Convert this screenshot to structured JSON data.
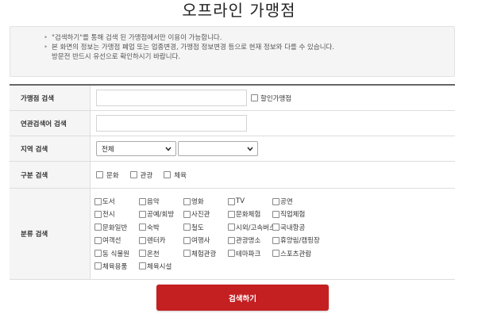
{
  "page": {
    "title": "오프라인 가맹점"
  },
  "notice": {
    "lines": [
      "\"검색하기\"를 통해 검색 된 가맹점에서만 이용이 가능합니다.",
      "본 화면의 정보는 가맹점 폐업 또는 업종변경, 가맹점 정보변경 등으로 현재 정보와 다를 수 있습니다.",
      "방문전 반드시 유선으로 확인하시기 바랍니다."
    ]
  },
  "form": {
    "store_search": {
      "label": "가맹점 검색",
      "value": "",
      "discount_label": "할인가맹점"
    },
    "keyword_search": {
      "label": "연관검색어 검색",
      "value": ""
    },
    "region_search": {
      "label": "지역 검색",
      "region1_selected": "전체",
      "region2_selected": ""
    },
    "type_search": {
      "label": "구분 검색",
      "options": [
        "문화",
        "관광",
        "체육"
      ]
    },
    "category_search": {
      "label": "분류 검색",
      "items": [
        "도서",
        "음악",
        "영화",
        "TV",
        "공연",
        "전시",
        "공예/회방",
        "사진관",
        "문화체험",
        "직업체험",
        "문화일반",
        "숙박",
        "철도",
        "시외/고속버스",
        "국내항공",
        "여객선",
        "렌터카",
        "여행사",
        "관광명소",
        "휴양림/캠핑장",
        "동 식물원",
        "온천",
        "체험관광",
        "테마파크",
        "스포츠관람",
        "체육용품",
        "체육시설"
      ]
    }
  },
  "search_button": {
    "label": "검색하기"
  },
  "colors": {
    "primary": "#c42022",
    "label_bg": "#f5f5f5",
    "border": "#dddddd"
  }
}
